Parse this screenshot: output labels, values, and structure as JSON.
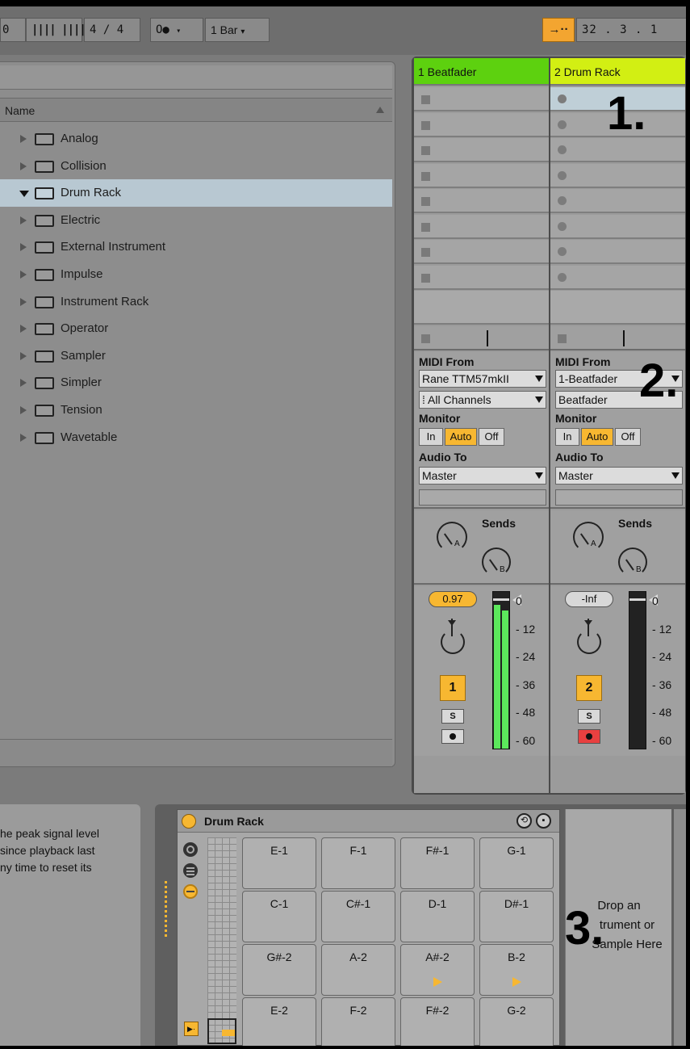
{
  "toolbar": {
    "left_glyph": "0",
    "metronome": "|||| ||||",
    "time_signature": "4 / 4",
    "record_mode": "O●",
    "quantize": "1 Bar",
    "position": "32 .  3 .  1"
  },
  "browser": {
    "column_header": "Name",
    "items": [
      {
        "label": "Analog",
        "expanded": false
      },
      {
        "label": "Collision",
        "expanded": false
      },
      {
        "label": "Drum Rack",
        "expanded": true
      },
      {
        "label": "Electric",
        "expanded": false
      },
      {
        "label": "External Instrument",
        "expanded": false
      },
      {
        "label": "Impulse",
        "expanded": false
      },
      {
        "label": "Instrument Rack",
        "expanded": false
      },
      {
        "label": "Operator",
        "expanded": false
      },
      {
        "label": "Sampler",
        "expanded": false
      },
      {
        "label": "Simpler",
        "expanded": false
      },
      {
        "label": "Tension",
        "expanded": false
      },
      {
        "label": "Wavetable",
        "expanded": false
      }
    ]
  },
  "tracks": [
    {
      "name": "1 Beatfader",
      "color": "#5dd10f",
      "io": {
        "midi_from_label": "MIDI From",
        "midi_from_value": "Rane TTM57mkII",
        "channel_value": "All Channels",
        "monitor_label": "Monitor",
        "monitor_in": "In",
        "monitor_auto": "Auto",
        "monitor_off": "Off",
        "audio_to_label": "Audio To",
        "audio_to_value": "Master"
      },
      "sends_label": "Sends",
      "send_a": "A",
      "send_b": "B",
      "volume": "0.97",
      "number": "1",
      "solo": "S"
    },
    {
      "name": "2 Drum Rack",
      "color": "#d2ef13",
      "io": {
        "midi_from_label": "MIDI From",
        "midi_from_value": "1-Beatfader",
        "channel_value": "Beatfader",
        "monitor_label": "Monitor",
        "monitor_in": "In",
        "monitor_auto": "Auto",
        "monitor_off": "Off",
        "audio_to_label": "Audio To",
        "audio_to_value": "Master"
      },
      "sends_label": "Sends",
      "send_a": "A",
      "send_b": "B",
      "volume": "-Inf",
      "number": "2",
      "solo": "S"
    }
  ],
  "meter_scale": [
    "0",
    "12",
    "24",
    "36",
    "48",
    "60"
  ],
  "info_text": [
    "he peak signal level",
    "since playback last",
    "ny time to reset its"
  ],
  "drum_rack": {
    "title": "Drum Rack",
    "pads": [
      [
        "E-1",
        "F-1",
        "F#-1",
        "G-1"
      ],
      [
        "C-1",
        "C#-1",
        "D-1",
        "D#-1"
      ],
      [
        "G#-2",
        "A-2",
        "A#-2",
        "B-2"
      ],
      [
        "E-2",
        "F-2",
        "F#-2",
        "G-2"
      ]
    ],
    "drop_text_1": "Drop an",
    "drop_text_2": "trument or",
    "drop_text_3": "Sample Here"
  },
  "annotations": [
    "1.",
    "2.",
    "3."
  ],
  "colors": {
    "accent": "#f7b731",
    "meter_green": "#5ce85c",
    "arm_red": "#e84040",
    "selection": "#b8c8d2"
  }
}
